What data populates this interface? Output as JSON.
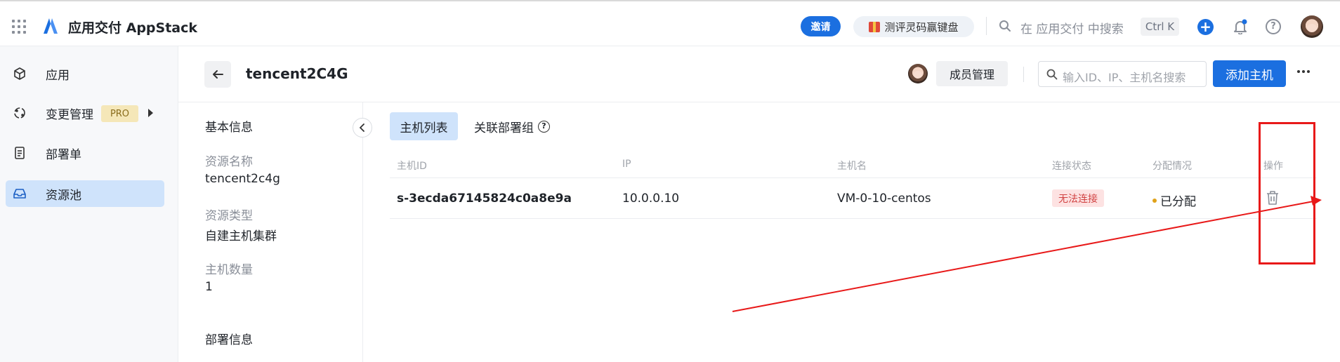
{
  "topbar": {
    "app_title": "应用交付 AppStack",
    "invite_label": "邀请",
    "promo_label": "测评灵码赢键盘",
    "search_placeholder": "在 应用交付 中搜索",
    "shortcut": "Ctrl K",
    "plus_label": "+",
    "help_label": "?"
  },
  "sidebar": {
    "items": [
      {
        "label": "应用",
        "icon": "cube-icon"
      },
      {
        "label": "变更管理",
        "icon": "change-icon",
        "badge": "PRO"
      },
      {
        "label": "部署单",
        "icon": "document-icon"
      },
      {
        "label": "资源池",
        "icon": "inbox-icon",
        "active": true
      }
    ]
  },
  "header": {
    "title": "tencent2C4G",
    "member_button": "成员管理",
    "search_placeholder": "输入ID、IP、主机名搜索",
    "add_button": "添加主机"
  },
  "info": {
    "basic_heading": "基本信息",
    "fields": [
      {
        "key": "资源名称",
        "value": "tencent2c4g"
      },
      {
        "key": "资源类型",
        "value": "自建主机集群"
      },
      {
        "key": "主机数量",
        "value": "1"
      }
    ],
    "deploy_heading": "部署信息"
  },
  "tabs": [
    {
      "label": "主机列表",
      "active": true
    },
    {
      "label": "关联部署组",
      "active": false
    }
  ],
  "table": {
    "columns": [
      "主机ID",
      "IP",
      "主机名",
      "连接状态",
      "分配情况",
      "操作"
    ],
    "rows": [
      {
        "host_id": "s-3ecda67145824c0a8e9a",
        "ip": "10.0.0.10",
        "hostname": "VM-0-10-centos",
        "status": "无法连接",
        "allocation": "已分配"
      }
    ]
  },
  "colors": {
    "primary": "#1b6fe0",
    "active_bg": "#cfe3fb",
    "status_error_bg": "#fde2e2",
    "status_error_text": "#d14343",
    "allocated_dot": "#e0a21a",
    "annotation_red": "#e81919"
  }
}
